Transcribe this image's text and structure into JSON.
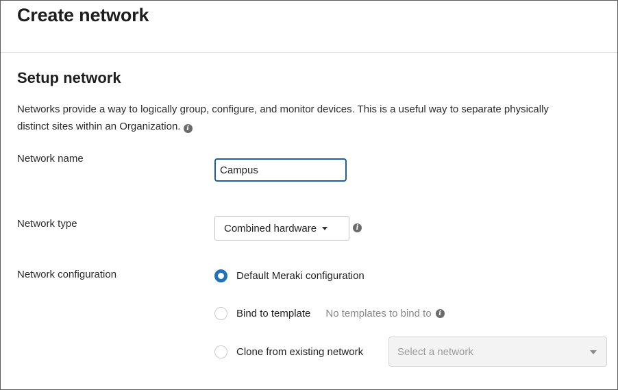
{
  "header": {
    "title": "Create network"
  },
  "section": {
    "title": "Setup network",
    "description": "Networks provide a way to logically group, configure, and monitor devices. This is a useful way to separate physically distinct sites within an Organization."
  },
  "fields": {
    "network_name": {
      "label": "Network name",
      "value": "Campus"
    },
    "network_type": {
      "label": "Network type",
      "selected": "Combined hardware"
    },
    "network_configuration": {
      "label": "Network configuration",
      "options": [
        {
          "label": "Default Meraki configuration",
          "checked": true
        },
        {
          "label": "Bind to template",
          "checked": false,
          "hint": "No templates to bind to"
        },
        {
          "label": "Clone from existing network",
          "checked": false,
          "placeholder": "Select a network"
        }
      ]
    }
  },
  "colors": {
    "accent": "#1f70c1",
    "input_border": "#1f5f9e",
    "muted_text": "#888888"
  },
  "icons": {
    "info": "info-icon",
    "dropdown": "caret-down-icon"
  }
}
